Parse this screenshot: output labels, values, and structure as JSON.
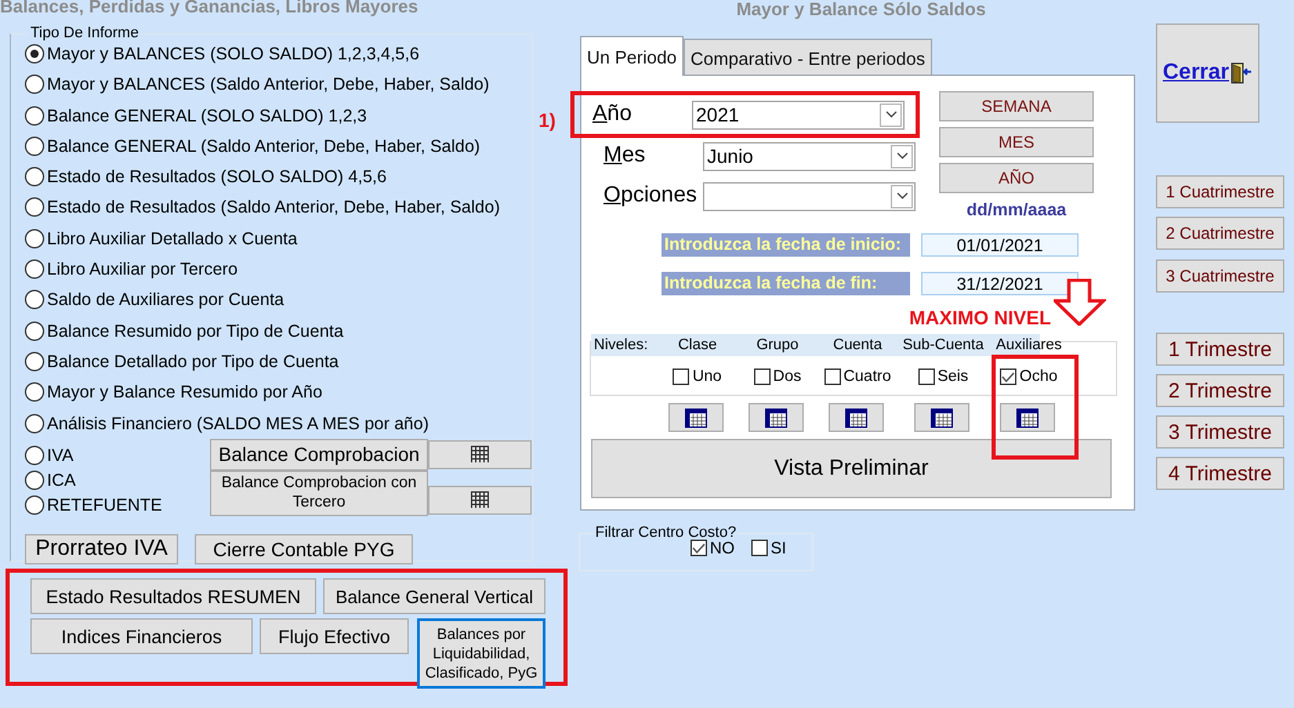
{
  "left_title": "Balances, Perdidas y Ganancias, Libros Mayores",
  "report_type": {
    "legend": "Tipo De Informe",
    "options": [
      {
        "label": "Mayor y BALANCES (SOLO SALDO) 1,2,3,4,5,6",
        "selected": true
      },
      {
        "label": "Mayor y BALANCES (Saldo Anterior, Debe, Haber, Saldo)",
        "selected": false
      },
      {
        "label": "Balance GENERAL (SOLO SALDO) 1,2,3",
        "selected": false
      },
      {
        "label": "Balance GENERAL (Saldo Anterior, Debe, Haber, Saldo)",
        "selected": false
      },
      {
        "label": "Estado de Resultados (SOLO SALDO) 4,5,6",
        "selected": false
      },
      {
        "label": "Estado de Resultados (Saldo Anterior, Debe, Haber, Saldo)",
        "selected": false
      },
      {
        "label": "Libro Auxiliar Detallado x Cuenta",
        "selected": false
      },
      {
        "label": "Libro Auxiliar por Tercero",
        "selected": false
      },
      {
        "label": "Saldo de Auxiliares por Cuenta",
        "selected": false
      },
      {
        "label": "Balance Resumido por Tipo de Cuenta",
        "selected": false
      },
      {
        "label": "Balance Detallado por Tipo de Cuenta",
        "selected": false
      },
      {
        "label": "Mayor y Balance Resumido por Año",
        "selected": false
      },
      {
        "label": "Análisis Financiero (SALDO MES A MES por año)",
        "selected": false
      }
    ],
    "tax_options": [
      {
        "label": "IVA",
        "selected": false
      },
      {
        "label": "ICA",
        "selected": false
      },
      {
        "label": "RETEFUENTE",
        "selected": false
      }
    ],
    "trial_balance_buttons": [
      "Balance Comprobacion",
      "Balance Comprobacion con Tercero"
    ],
    "bottom_buttons": [
      "Prorrateo IVA",
      "Cierre Contable PYG"
    ]
  },
  "highlighted_buttons": [
    [
      {
        "label": "Estado Resultados RESUMEN",
        "focused": false
      },
      {
        "label": "Balance General Vertical",
        "focused": false
      }
    ],
    [
      {
        "label": "Indices Financieros",
        "focused": false
      },
      {
        "label": "Flujo Efectivo",
        "focused": false
      },
      {
        "label": "Balances por Liquidabilidad, Clasificado, PyG",
        "focused": true
      }
    ]
  ],
  "annotation_number": "1)",
  "center_title": "Mayor y Balance Sólo Saldos",
  "tabs": [
    {
      "label": "Un Periodo",
      "selected": true
    },
    {
      "label": "Comparativo - Entre periodos",
      "selected": false
    }
  ],
  "selectors": [
    {
      "label": "Año",
      "value": "2021",
      "highlighted": true
    },
    {
      "label": "Mes",
      "value": "Junio",
      "highlighted": false
    },
    {
      "label": "Opciones",
      "highlighted": false
    }
  ],
  "period_buttons": [
    "SEMANA",
    "MES",
    "AÑO"
  ],
  "date_format": "dd/mm/aaaa",
  "dates": [
    {
      "label": "Introduzca la fecha de inicio:",
      "value": "01/01/2021"
    },
    {
      "label": "Introduzca la fecha de fin:",
      "value": "31/12/2021"
    }
  ],
  "max_level_note": "MAXIMO NIVEL",
  "levels": {
    "title": "Niveles:",
    "items": [
      {
        "header": "Clase",
        "label": "Uno",
        "checked": false
      },
      {
        "header": "Grupo",
        "label": "Dos",
        "checked": false
      },
      {
        "header": "Cuenta",
        "label": "Cuatro",
        "checked": false
      },
      {
        "header": "Sub-Cuenta",
        "label": "Seis",
        "checked": false
      },
      {
        "header": "Auxiliares",
        "label": "Ocho",
        "checked": true
      }
    ]
  },
  "preview_button": "Vista Preliminar",
  "cost_center_filter": {
    "legend": "Filtrar Centro Costo?",
    "options": [
      {
        "label": "NO",
        "checked": true
      },
      {
        "label": "SI",
        "checked": false
      }
    ]
  },
  "close_button": "Cerrar",
  "cuatrimestre_buttons": [
    "1 Cuatrimestre",
    "2 Cuatrimestre",
    "3 Cuatrimestre"
  ],
  "trimestre_buttons": [
    "1 Trimestre",
    "2 Trimestre",
    "3 Trimestre",
    "4 Trimestre"
  ]
}
